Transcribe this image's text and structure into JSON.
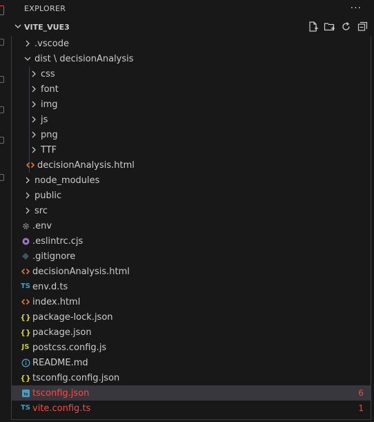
{
  "pane": {
    "title": "EXPLORER",
    "more": "···"
  },
  "section": {
    "title": "VITE_VUE3"
  },
  "tree": [
    {
      "label": ".vscode",
      "type": "folder",
      "depth": 0,
      "open": false
    },
    {
      "label": "dist \\ decisionAnalysis",
      "type": "folder",
      "depth": 0,
      "open": true
    },
    {
      "label": "css",
      "type": "folder",
      "depth": 1,
      "open": false
    },
    {
      "label": "font",
      "type": "folder",
      "depth": 1,
      "open": false
    },
    {
      "label": "img",
      "type": "folder",
      "depth": 1,
      "open": false
    },
    {
      "label": "js",
      "type": "folder",
      "depth": 1,
      "open": false
    },
    {
      "label": "png",
      "type": "folder",
      "depth": 1,
      "open": false
    },
    {
      "label": "TTF",
      "type": "folder",
      "depth": 1,
      "open": false
    },
    {
      "label": "decisionAnalysis.html",
      "type": "html",
      "depth": 1
    },
    {
      "label": "node_modules",
      "type": "folder",
      "depth": 0,
      "open": false
    },
    {
      "label": "public",
      "type": "folder",
      "depth": 0,
      "open": false
    },
    {
      "label": "src",
      "type": "folder",
      "depth": 0,
      "open": false
    },
    {
      "label": ".env",
      "type": "env",
      "depth": 0
    },
    {
      "label": ".eslintrc.cjs",
      "type": "eslint",
      "depth": 0
    },
    {
      "label": ".gitignore",
      "type": "git",
      "depth": 0
    },
    {
      "label": "decisionAnalysis.html",
      "type": "html",
      "depth": 0
    },
    {
      "label": "env.d.ts",
      "type": "ts",
      "depth": 0
    },
    {
      "label": "index.html",
      "type": "html",
      "depth": 0
    },
    {
      "label": "package-lock.json",
      "type": "json",
      "depth": 0
    },
    {
      "label": "package.json",
      "type": "json",
      "depth": 0
    },
    {
      "label": "postcss.config.js",
      "type": "js",
      "depth": 0
    },
    {
      "label": "README.md",
      "type": "info",
      "depth": 0
    },
    {
      "label": "tsconfig.config.json",
      "type": "json",
      "depth": 0
    },
    {
      "label": "tsconfig.json",
      "type": "tsconfig",
      "depth": 0,
      "selected": true,
      "error": true,
      "badge": "6"
    },
    {
      "label": "vite.config.ts",
      "type": "ts",
      "depth": 0,
      "error": true,
      "badge": "1"
    }
  ],
  "colors": {
    "html": "#e37933",
    "ts": "#519aba",
    "json": "#cbcb41",
    "js": "#cbcb41",
    "env": "#8b8b8b",
    "eslint": "#a074c4",
    "git": "#41535b",
    "info": "#519aba",
    "error": "#f14c4c",
    "chevron": "#c5c5c5"
  }
}
